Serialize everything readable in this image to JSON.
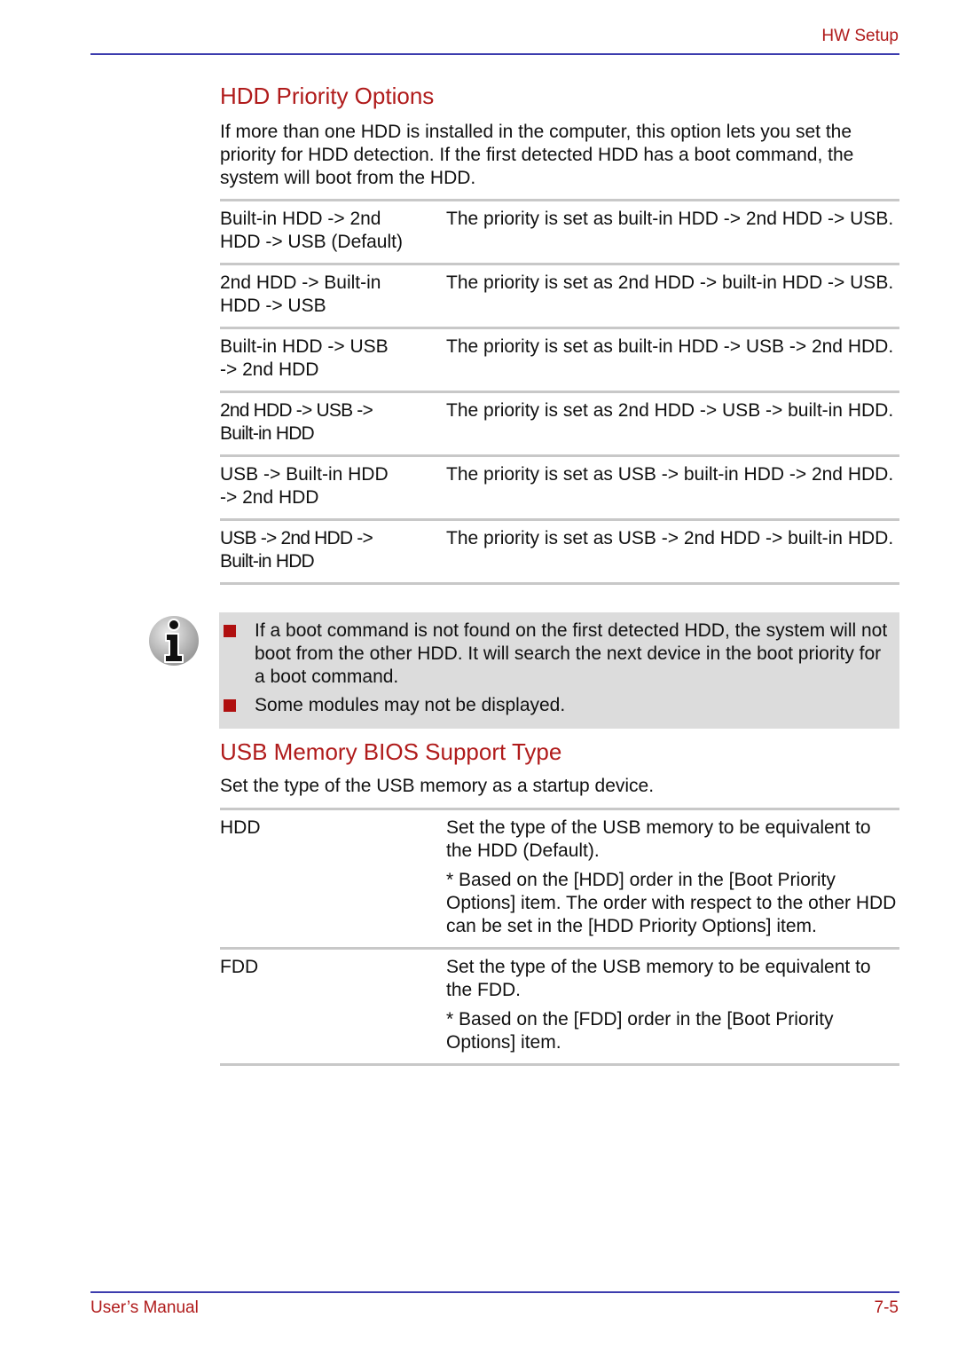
{
  "header": {
    "section": "HW Setup"
  },
  "hdd_priority": {
    "title": "HDD Priority Options",
    "intro": "If more than one HDD is installed in the computer, this option lets you set the priority for HDD detection. If the first detected HDD has a boot command, the system will boot from the HDD.",
    "options": [
      {
        "key": "Built-in HDD -> 2nd HDD -> USB (Default)",
        "desc": "The priority is set as built-in HDD -> 2nd HDD -> USB."
      },
      {
        "key": "2nd HDD -> Built-in HDD -> USB",
        "desc": "The priority is set as 2nd HDD -> built-in HDD -> USB."
      },
      {
        "key": "Built-in HDD -> USB -> 2nd HDD",
        "desc": "The priority is set as built-in HDD -> USB -> 2nd HDD."
      },
      {
        "key": "2nd HDD -> USB -> Built-in HDD",
        "desc": "The priority is set as 2nd HDD -> USB -> built-in HDD."
      },
      {
        "key": "USB -> Built-in HDD -> 2nd HDD",
        "desc": "The priority is set as USB -> built-in HDD -> 2nd HDD."
      },
      {
        "key": "USB -> 2nd HDD -> Built-in HDD",
        "desc": "The priority is set as USB -> 2nd HDD -> built-in HDD."
      }
    ]
  },
  "note": {
    "icon": "info-icon",
    "items": [
      "If a boot command is not found on the first detected HDD, the system will not boot from the other HDD. It will search the next device in the boot priority for a boot command.",
      "Some modules may not be displayed."
    ]
  },
  "usb_memory": {
    "title": "USB Memory BIOS Support Type",
    "intro": "Set the type of the USB memory as a startup device.",
    "options": [
      {
        "key": "HDD",
        "desc": "Set the type of the USB memory to be equivalent to the HDD (Default).",
        "note": "* Based on the [HDD] order in the [Boot Priority Options] item. The order with respect to the other HDD can be set in the [HDD Priority Options] item."
      },
      {
        "key": "FDD",
        "desc": "Set the type of the USB memory to be equivalent to the FDD.",
        "note": "* Based on the [FDD] order in the [Boot Priority Options] item."
      }
    ]
  },
  "footer": {
    "left": "User’s Manual",
    "right": "7-5"
  },
  "colors": {
    "accent_red": "#b01b1b",
    "rule_blue": "#3c3cae",
    "note_bg": "#dcdcdc",
    "divider_gray": "#c8c8c8"
  }
}
